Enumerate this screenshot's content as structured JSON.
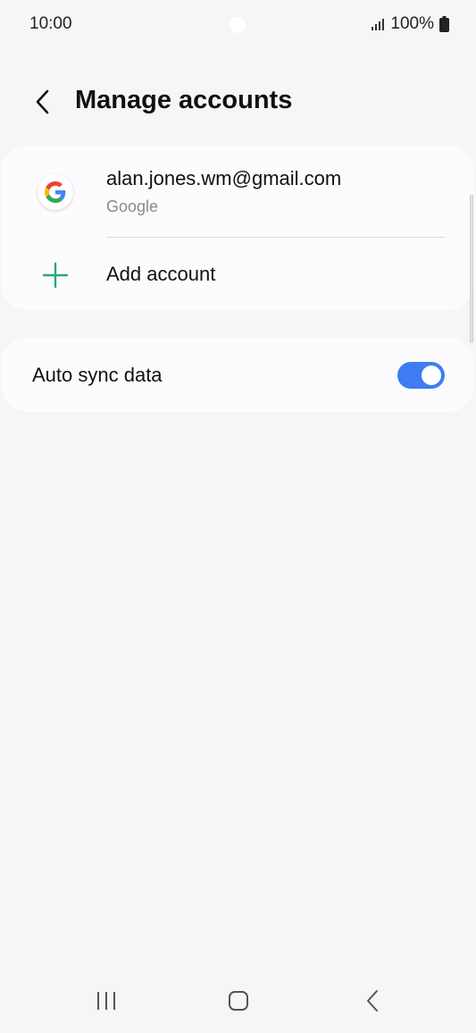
{
  "status_bar": {
    "time": "10:00",
    "battery_text": "100%",
    "icons": [
      "signal-icon",
      "battery-icon"
    ]
  },
  "header": {
    "title": "Manage accounts",
    "back_icon": "chevron-left-icon"
  },
  "accounts": {
    "items": [
      {
        "email": "alan.jones.wm@gmail.com",
        "provider": "Google",
        "icon": "google-icon"
      }
    ],
    "add_label": "Add account",
    "add_icon": "plus-icon"
  },
  "sync": {
    "label": "Auto sync data",
    "enabled": true
  },
  "nav_bar": {
    "icons": [
      "recents-icon",
      "home-icon",
      "back-icon"
    ]
  },
  "colors": {
    "background": "#f6f6f8",
    "card": "#fcfcfe",
    "accent": "#3e7cf2",
    "add_icon": "#2aa876",
    "secondary_text": "#8a8a8a"
  }
}
